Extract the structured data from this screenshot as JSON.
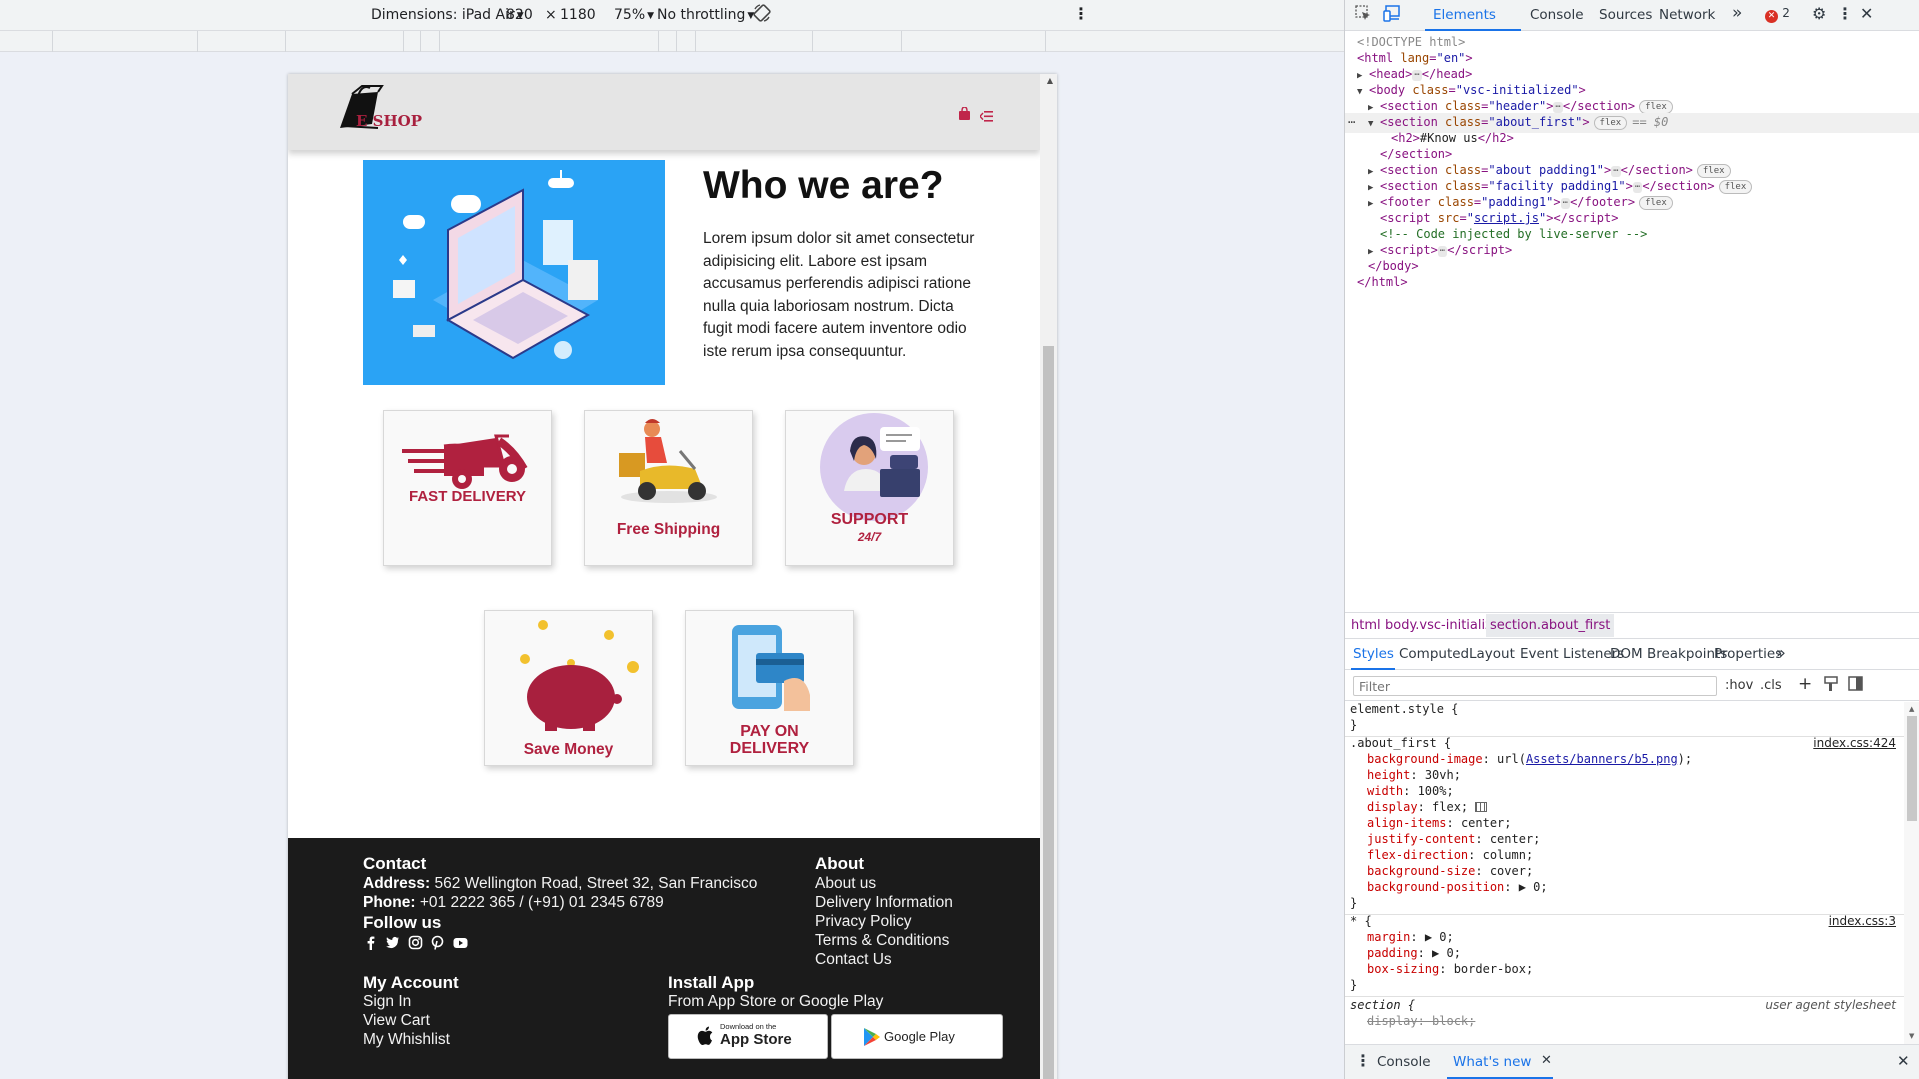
{
  "device_toolbar": {
    "dimensions_label": "Dimensions: iPad Air",
    "width_value": "820",
    "times": "×",
    "height_value": "1180",
    "zoom": "75%",
    "throttling": "No throttling",
    "rotate_icon": "rotate-icon",
    "more_icon": "kebab-menu-icon"
  },
  "site": {
    "header": {
      "logo_text": "E SHOP",
      "cart_icon": "shopping-bag-icon",
      "menu_icon": "menu-icon",
      "brand_color": "#a8203e"
    },
    "about": {
      "heading": "Who we are?",
      "paragraph": "Lorem ipsum dolor sit amet consectetur adipisicing elit. Labore est ipsam accusamus perferendis adipisci ratione nulla quia laboriosam nostrum. Dicta fugit modi facere autem inventore odio iste rerum ipsa consequuntur."
    },
    "facilities": [
      {
        "label": "FAST DELIVERY",
        "icon": "scooter-icon"
      },
      {
        "label": "Free Shipping",
        "icon": "delivery-rider-icon"
      },
      {
        "label": "SUPPORT",
        "sub": "24/7",
        "icon": "support-agent-icon"
      },
      {
        "label": "Save Money",
        "icon": "piggy-bank-icon"
      },
      {
        "label": "PAY ON",
        "sub": "DELIVERY",
        "icon": "card-payment-icon"
      }
    ],
    "footer": {
      "contact_title": "Contact",
      "address_label": "Address:",
      "address_value": "562 Wellington Road, Street 32, San Francisco",
      "phone_label": "Phone:",
      "phone_value": "+01 2222 365 / (+91) 01 2345 6789",
      "follow_title": "Follow us",
      "social_icons": [
        "facebook-icon",
        "twitter-icon",
        "instagram-icon",
        "pinterest-icon",
        "youtube-icon"
      ],
      "about_title": "About",
      "about_links": [
        "About us",
        "Delivery Information",
        "Privacy Policy",
        "Terms & Conditions",
        "Contact Us"
      ],
      "account_title": "My Account",
      "account_links": [
        "Sign In",
        "View Cart",
        "My Whishlist"
      ],
      "install_title": "Install App",
      "install_sub": "From App Store or Google Play",
      "app_store_small": "Download on the",
      "app_store_big": "App Store",
      "google_play": "Google Play"
    }
  },
  "devtools": {
    "tabs": [
      "Elements",
      "Console",
      "Sources",
      "Network"
    ],
    "active_tab": "Elements",
    "more_tabs": "»",
    "error_count": "2",
    "dom": {
      "doctype": "<!DOCTYPE html>",
      "html_open": "<html ",
      "html_attr": "lang",
      "html_val": "\"en\"",
      "head_open": "<head>",
      "head_close": "</head>",
      "body_open": "<body ",
      "body_attr": "class",
      "body_val": "\"vsc-initialized\"",
      "sec_header": "\"header\"",
      "sec_about_first": "\"about_first\"",
      "h2_text": "#Know us",
      "sec_about": "\"about padding1\"",
      "sec_facility": "\"facility padding1\"",
      "footer_val": "\"padding1\"",
      "script_src": "script.js",
      "comment": "<!-- Code injected by live-server -->",
      "body_close": "</body>",
      "html_close": "</html>",
      "badge_flex": "flex",
      "eq0": "== $0"
    },
    "breadcrumb": [
      "html",
      "body.vsc-initialized",
      "section.about_first"
    ],
    "styles_tabs": [
      "Styles",
      "Computed",
      "Layout",
      "Event Listeners",
      "DOM Breakpoints",
      "Properties"
    ],
    "filter_placeholder": "Filter",
    "filter_buttons": [
      ":hov",
      ".cls",
      "+"
    ],
    "rules": {
      "element_style": "element.style {",
      "about_first_sel": ".about_first {",
      "about_first_src": "index.css:424",
      "bg_image_url": "Assets/banners/b5.png",
      "props": [
        [
          "background-image",
          "url(Assets/banners/b5.png);"
        ],
        [
          "height",
          "30vh;"
        ],
        [
          "width",
          "100%;"
        ],
        [
          "display",
          "flex;"
        ],
        [
          "align-items",
          "center;"
        ],
        [
          "justify-content",
          "center;"
        ],
        [
          "flex-direction",
          "column;"
        ],
        [
          "background-size",
          "cover;"
        ],
        [
          "background-position",
          "▶ 0;"
        ]
      ],
      "universal_sel": "* {",
      "universal_src": "index.css:3",
      "universal_props": [
        [
          "margin",
          "▶ 0;"
        ],
        [
          "padding",
          "▶ 0;"
        ],
        [
          "box-sizing",
          "border-box;"
        ]
      ],
      "section_sel": "section {",
      "section_src": "user agent stylesheet",
      "section_prop": "display: block;"
    },
    "drawer_tabs": [
      "Console",
      "What's new"
    ],
    "accent": "#1a73e8"
  }
}
